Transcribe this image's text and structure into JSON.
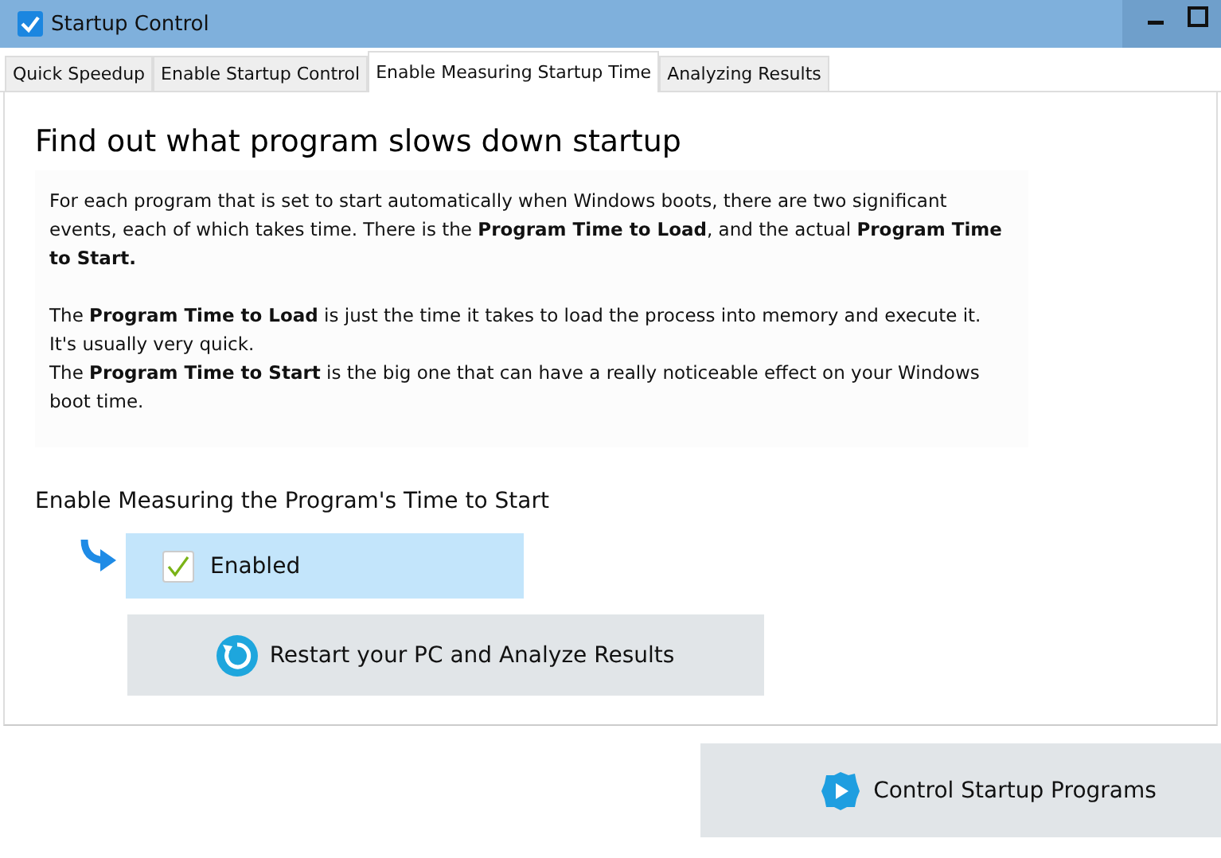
{
  "window": {
    "title": "Startup Control",
    "checked": true
  },
  "tabs": [
    {
      "label": "Quick Speedup",
      "selected": false
    },
    {
      "label": "Enable Startup Control",
      "selected": false
    },
    {
      "label": "Enable Measuring Startup Time",
      "selected": true
    },
    {
      "label": "Analyzing Results",
      "selected": false
    }
  ],
  "heading": "Find out what program slows down startup",
  "description": [
    "For each program that is set to start automatically when Windows boots, there are two significant events, each of which takes time.  There is the **Program Time to Load**, and the actual **Program Time to Start.**",
    "The **Program Time to Load** is just the time it takes to load the process into memory and execute it. It's usually very quick.",
    "The **Program Time to Start** is the big one that can have a really noticeable effect on your Windows boot time."
  ],
  "section_label": "Enable Measuring the Program's Time to Start",
  "enable_option": {
    "label": "Enabled",
    "checked": true
  },
  "restart_button": "Restart your PC and Analyze Results",
  "control_button": "Control Startup Programs"
}
